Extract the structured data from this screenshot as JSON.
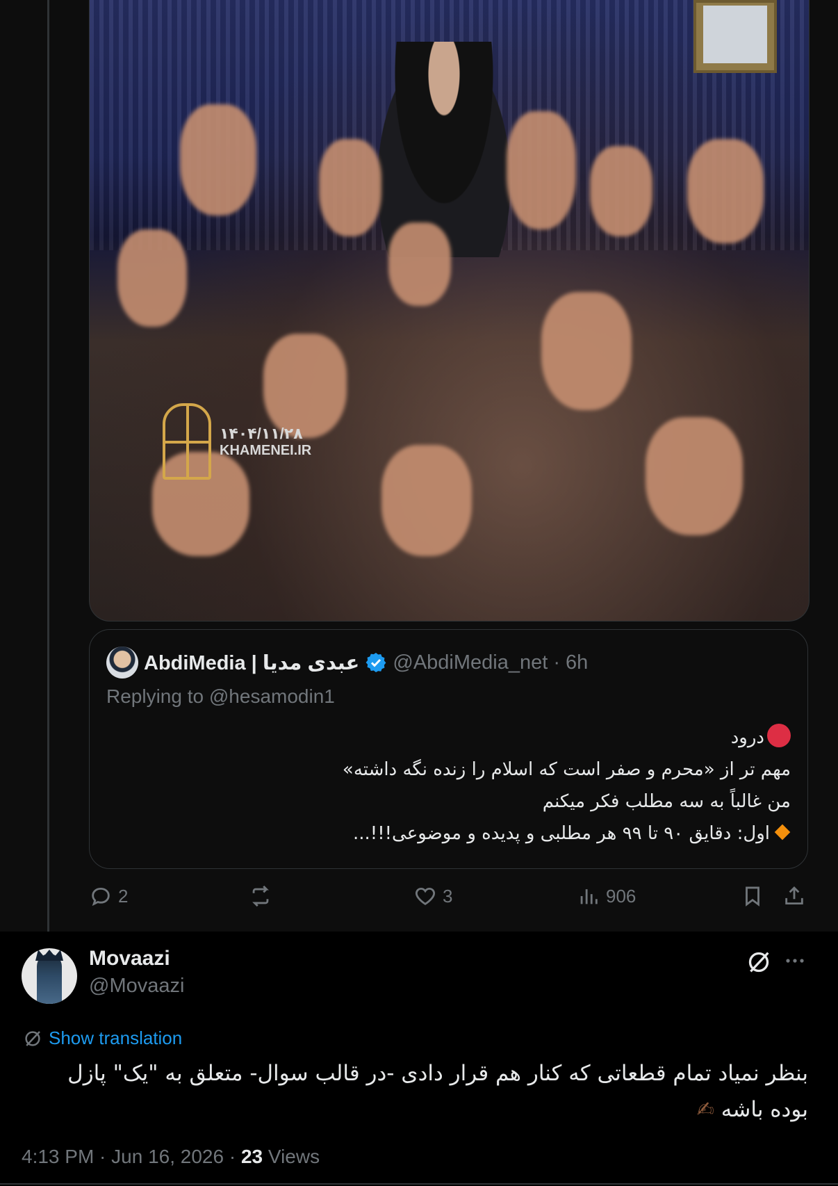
{
  "quoted_post": {
    "media_watermark": {
      "date": "۱۴۰۴/۱۱/۲۸",
      "site": "KHAMENEI.IR"
    },
    "display_name": "AbdiMedia | عبدی مدیا",
    "handle_time": "@AbdiMedia_net · 6h",
    "replying_prefix": "Replying to",
    "replying_user": "@hesamodin1",
    "lines": [
      "درود",
      "مهم تر از «محرم و صفر است که اسلام را زنده نگه داشته»",
      "من غالباً به سه مطلب فکر میکنم",
      "اول: دقایق ۹۰ تا ۹۹ هر مطلبی و پدیده و موضوعی!!!..."
    ]
  },
  "actions": {
    "replies": "2",
    "reposts": "",
    "likes": "3",
    "views": "906"
  },
  "post": {
    "display_name": "Movaazi",
    "handle": "@Movaazi",
    "show_translation": "Show translation",
    "lines": [
      "بنظر نمیاد تمام قطعاتی که کنار هم قرار دادی -در قالب سوال- متعلق به \"یک\" پازل",
      "بوده باشه"
    ],
    "emoji": "✍",
    "time_date": "4:13 PM · Jun 16, 2026 ·",
    "views_count": "23",
    "views_label": "Views"
  },
  "colors": {
    "accent": "#1d9bf0",
    "verified": "#1d9bf0",
    "muted": "#71767b"
  }
}
